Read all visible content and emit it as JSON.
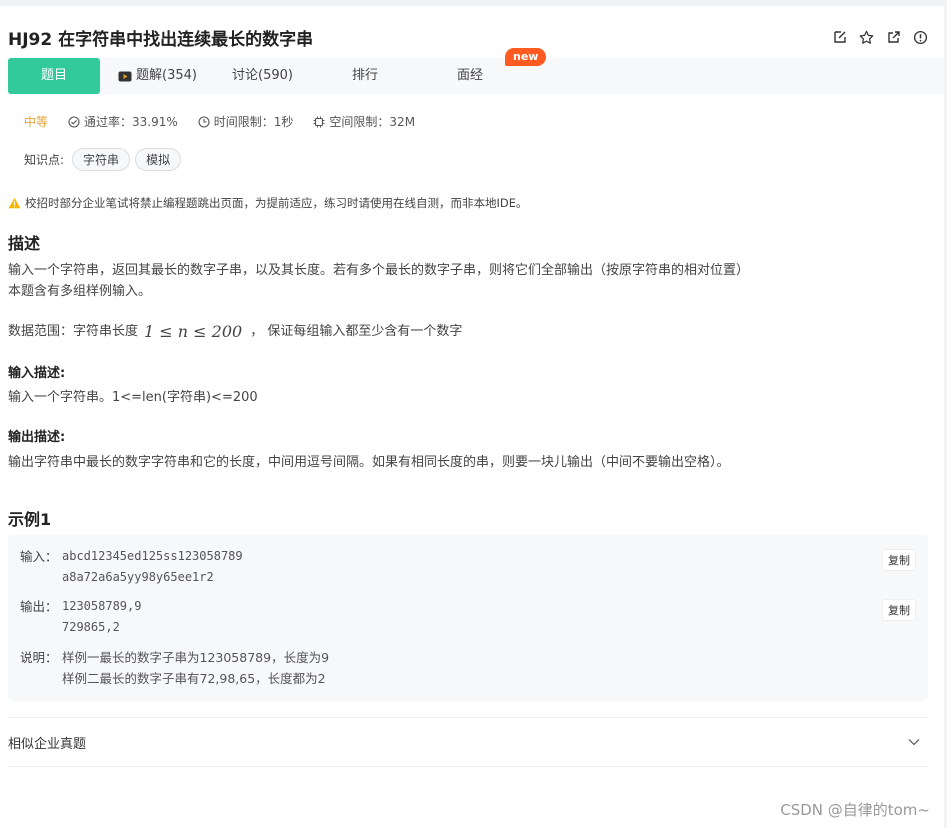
{
  "title": "HJ92  在字符串中找出连续最长的数字串",
  "icons": [
    "edit-icon",
    "star-icon",
    "external-link-icon",
    "info-icon"
  ],
  "tabs": [
    {
      "label": "题目"
    },
    {
      "label": "题解(354)"
    },
    {
      "label": "讨论(590)"
    },
    {
      "label": "排行"
    },
    {
      "label": "面经"
    }
  ],
  "new_badge": "new",
  "meta": {
    "difficulty": "中等",
    "pass_rate": "通过率：33.91%",
    "time_limit": "时间限制：1秒",
    "space_limit": "空间限制：32M"
  },
  "knowledge": {
    "label": "知识点:",
    "tags": [
      "字符串",
      "模拟"
    ]
  },
  "notice": "校招时部分企业笔试将禁止编程题跳出页面，为提前适应，练习时请使用在线自测，而非本地IDE。",
  "description": {
    "heading": "描述",
    "line1": "输入一个字符串，返回其最长的数字子串，以及其长度。若有多个最长的数字子串，则将它们全部输出（按原字符串的相对位置）",
    "line2": "本题含有多组样例输入。",
    "range_prefix": "数据范围：字符串长度",
    "range_math": "1 ≤ n ≤ 200",
    "range_suffix": "， 保证每组输入都至少含有一个数字"
  },
  "input_desc": {
    "heading": "输入描述:",
    "text": "输入一个字符串。1<=len(字符串)<=200"
  },
  "output_desc": {
    "heading": "输出描述:",
    "text": "输出字符串中最长的数字字符串和它的长度，中间用逗号间隔。如果有相同长度的串，则要一块儿输出（中间不要输出空格）。"
  },
  "example": {
    "heading": "示例1",
    "input_label": "输入：",
    "input_lines": [
      "abcd12345ed125ss123058789",
      "a8a72a6a5yy98y65ee1r2"
    ],
    "output_label": "输出：",
    "output_lines": [
      "123058789,9",
      "729865,2"
    ],
    "explain_label": "说明：",
    "explain_lines": [
      "样例一最长的数字子串为123058789，长度为9",
      "样例二最长的数字子串有72,98,65，长度都为2"
    ],
    "copy_label": "复制"
  },
  "similar": {
    "label": "相似企业真题"
  },
  "watermark": "CSDN @自律的tom~"
}
